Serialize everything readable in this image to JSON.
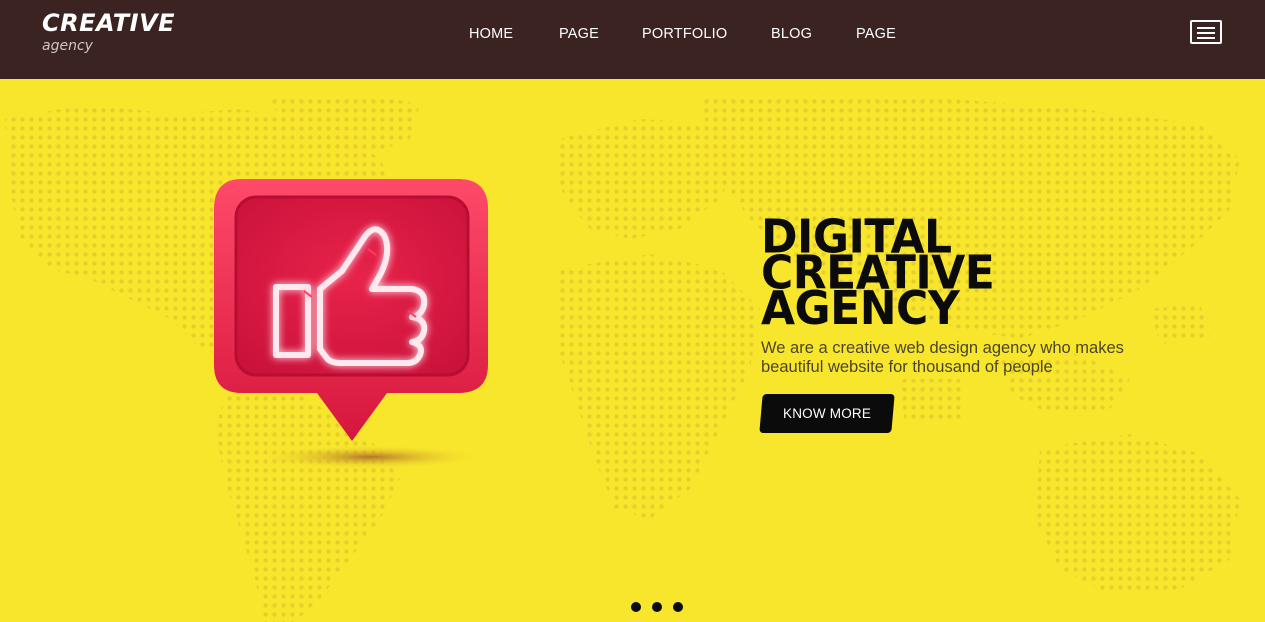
{
  "brand": {
    "name": "CREATIVE",
    "tagline": "agency"
  },
  "nav": {
    "items": [
      "HOME",
      "PAGE",
      "PORTFOLIO",
      "BLOG",
      "PAGE"
    ]
  },
  "menu": {
    "icon": "hamburger-menu-icon"
  },
  "hero": {
    "headline": [
      "DIGITAL",
      "CREATIVE",
      "AGENCY"
    ],
    "description_lines": [
      "We are a creative web design agency who makes",
      "beautiful website for thousand of people"
    ],
    "cta_label": "KNOW MORE",
    "illustration": "thumbs-up-icon",
    "background": "world-map-dots"
  },
  "slider": {
    "dot_count": 3
  },
  "colors": {
    "header_bg": "#3b2322",
    "hero_bg": "#f8e62c",
    "map_dots": "#e6cf2c",
    "bubble": "#e8234a",
    "neon": "#ffe9ef",
    "button_bg": "#0b0b0b",
    "text_dark": "#0b0b0b"
  }
}
